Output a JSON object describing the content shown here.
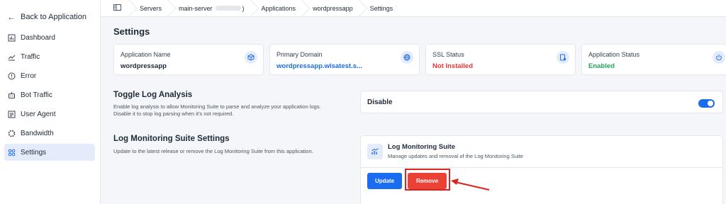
{
  "sidebar": {
    "back_label": "Back to Application",
    "items": [
      {
        "label": "Dashboard",
        "icon": "dashboard-icon",
        "active": false
      },
      {
        "label": "Traffic",
        "icon": "traffic-icon",
        "active": false
      },
      {
        "label": "Error",
        "icon": "error-icon",
        "active": false
      },
      {
        "label": "Bot Traffic",
        "icon": "bot-icon",
        "active": false
      },
      {
        "label": "User Agent",
        "icon": "user-agent-icon",
        "active": false
      },
      {
        "label": "Bandwidth",
        "icon": "bandwidth-icon",
        "active": false
      },
      {
        "label": "Settings",
        "icon": "settings-icon",
        "active": true
      }
    ]
  },
  "breadcrumb": {
    "items": [
      "Servers",
      "main-server",
      "Applications",
      "wordpressapp",
      "Settings"
    ],
    "server_suffix": ")"
  },
  "page": {
    "title": "Settings"
  },
  "info_cards": [
    {
      "label": "Application Name",
      "value": "wordpressapp",
      "icon": "cube-icon",
      "value_color": "#1f2937"
    },
    {
      "label": "Primary Domain",
      "value": "wordpressapp.wlsatest.s...",
      "icon": "globe-icon",
      "value_color": "#1a6cf0"
    },
    {
      "label": "SSL Status",
      "value": "Not Installed",
      "icon": "ssl-icon",
      "value_color": "#e53935"
    },
    {
      "label": "Application Status",
      "value": "Enabled",
      "icon": "power-icon",
      "value_color": "#22a55b"
    }
  ],
  "toggle_log": {
    "title": "Toggle Log Analysis",
    "description_1": "Enable log analysis to allow Monitoring Suite to parse and analyze your application logs.",
    "description_2": "Disable it to stop log parsing when it's not required.",
    "toggle_label": "Disable",
    "enabled": true
  },
  "log_suite": {
    "title": "Log Monitoring Suite Settings",
    "description": "Update to the latest release or remove the Log Monitoring Suite from this application.",
    "card_title": "Log Monitoring Suite",
    "card_subtitle": "Manage updates and removal of the Log Monitoring Suite",
    "update_label": "Update",
    "remove_label": "Remove"
  },
  "colors": {
    "accent": "#1a6cf0",
    "danger": "#ea4335",
    "annotation": "#e0201e"
  }
}
